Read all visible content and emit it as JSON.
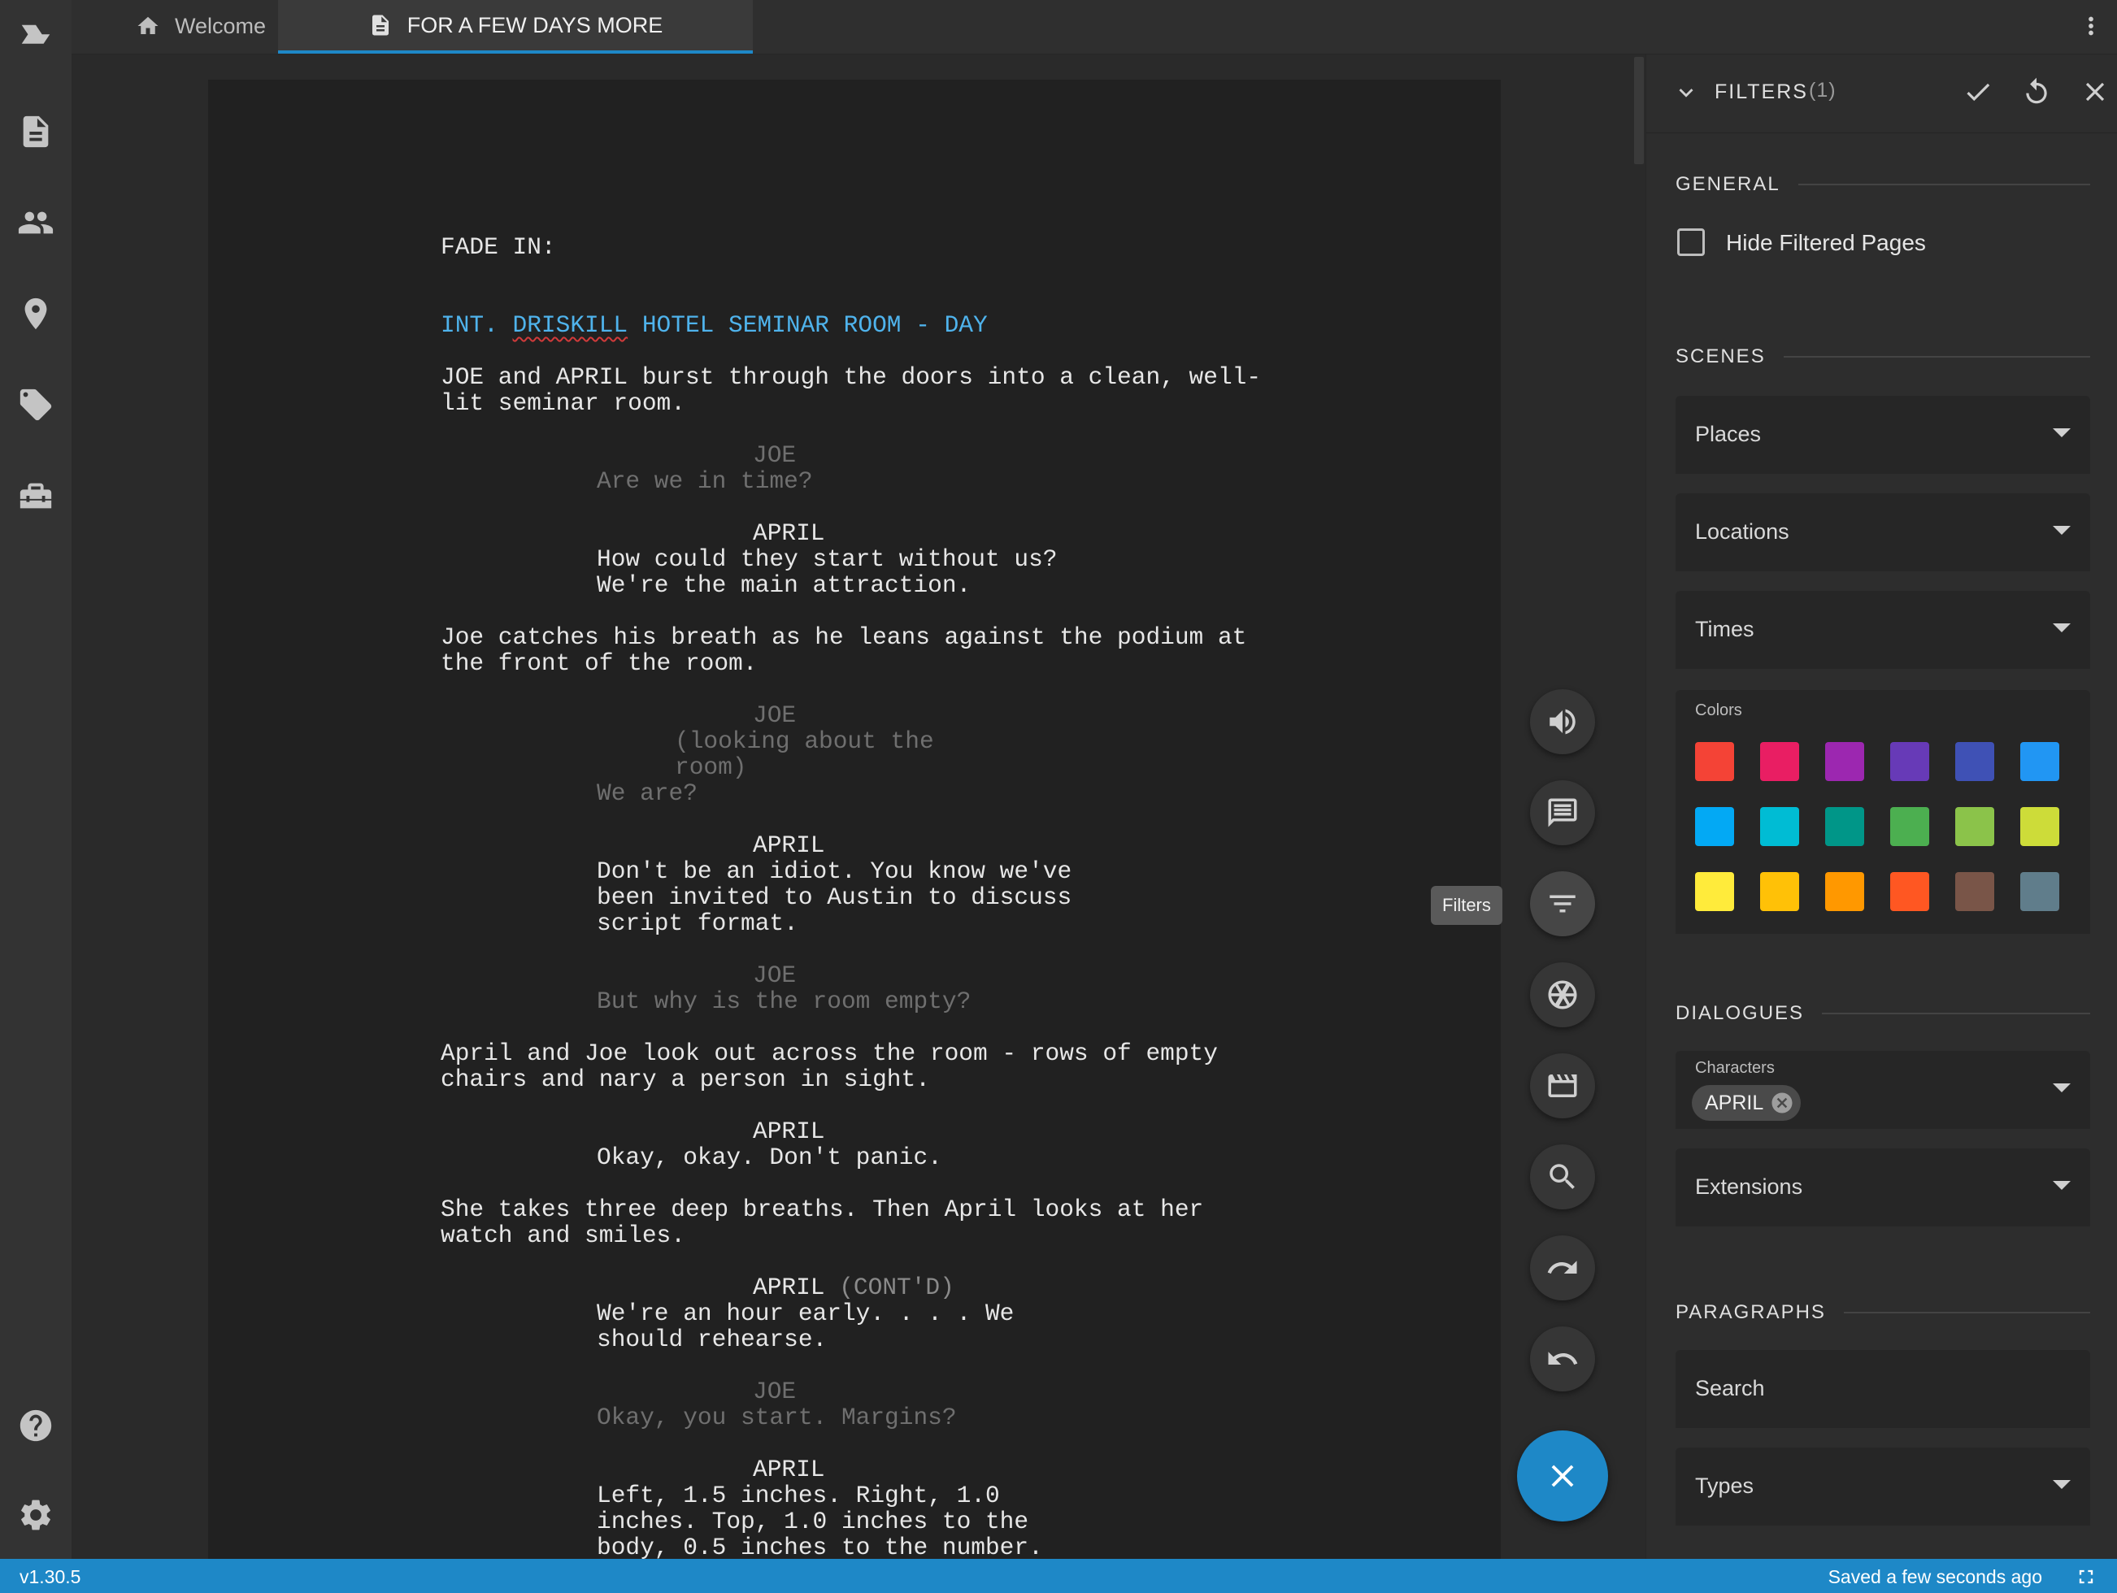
{
  "app": {
    "version": "v1.30.5",
    "status": "Saved a few seconds ago"
  },
  "activity_bar": {
    "items": [
      "logo-icon",
      "document-icon",
      "people-icon",
      "location-pin-icon",
      "tag-icon",
      "toolbox-icon"
    ],
    "bottom": [
      "help-icon",
      "settings-gear-icon"
    ]
  },
  "tabs": [
    {
      "label": "Welcome",
      "icon": "home-icon",
      "active": false
    },
    {
      "label": "FOR A FEW DAYS MORE",
      "icon": "document-icon",
      "active": true
    }
  ],
  "script": {
    "lines": [
      {
        "text": "FADE IN:",
        "style": "normal"
      },
      {
        "text": "INT. DRISKILL HOTEL SEMINAR ROOM - DAY",
        "style": "scene"
      },
      {
        "text": "JOE and APRIL burst through the doors into a clean, well-",
        "style": "normal"
      },
      {
        "text": "lit seminar room.",
        "style": "normal"
      },
      {
        "text": "JOE",
        "style": "dim"
      },
      {
        "text": "Are we in time?",
        "style": "dim"
      },
      {
        "text": "APRIL",
        "style": "normal"
      },
      {
        "text": "How could they start without us?",
        "style": "normal"
      },
      {
        "text": "We're the main attraction.",
        "style": "normal"
      },
      {
        "text": "Joe catches his breath as he leans against the podium at",
        "style": "normal"
      },
      {
        "text": "the front of the room.",
        "style": "normal"
      },
      {
        "text": "JOE",
        "style": "dim"
      },
      {
        "text": "(looking about the",
        "style": "dim"
      },
      {
        "text": "room)",
        "style": "dim"
      },
      {
        "text": "We are?",
        "style": "dim"
      },
      {
        "text": "APRIL",
        "style": "normal"
      },
      {
        "text": "Don't be an idiot. You know we've",
        "style": "normal"
      },
      {
        "text": "been invited to Austin to discuss",
        "style": "normal"
      },
      {
        "text": "script format.",
        "style": "normal"
      },
      {
        "text": "JOE",
        "style": "dim"
      },
      {
        "text": "But why is the room empty?",
        "style": "dim"
      },
      {
        "text": "April and Joe look out across the room - rows of empty",
        "style": "normal"
      },
      {
        "text": "chairs and nary a person in sight.",
        "style": "normal"
      },
      {
        "text": "APRIL",
        "style": "normal"
      },
      {
        "text": "Okay, okay. Don't panic.",
        "style": "normal"
      },
      {
        "text": "She takes three deep breaths. Then April looks at her",
        "style": "normal"
      },
      {
        "text": "watch and smiles.",
        "style": "normal"
      },
      {
        "text": "APRIL",
        "style": "normal",
        "extension": "(CONT'D)"
      },
      {
        "text": "We're an hour early. . . . We",
        "style": "normal"
      },
      {
        "text": "should rehearse.",
        "style": "normal"
      },
      {
        "text": "JOE",
        "style": "dim"
      },
      {
        "text": "Okay, you start. Margins?",
        "style": "dim"
      },
      {
        "text": "APRIL",
        "style": "normal"
      },
      {
        "text": "Left, 1.5 inches. Right, 1.0",
        "style": "normal"
      },
      {
        "text": "inches. Top, 1.0 inches to the",
        "style": "normal"
      },
      {
        "text": "body, 0.5 inches to the number.",
        "style": "normal"
      }
    ]
  },
  "toolbar": {
    "buttons": [
      "speaker-icon",
      "comment-icon",
      "filter-icon",
      "aperture-icon",
      "clapperboard-icon",
      "search-icon",
      "redo-icon",
      "undo-icon"
    ],
    "tooltip": "Filters",
    "close": "close-icon"
  },
  "filters": {
    "title": "FILTERS",
    "count": "(1)",
    "general": {
      "heading": "GENERAL",
      "hide_filtered_pages": "Hide Filtered Pages"
    },
    "scenes": {
      "heading": "SCENES",
      "places": "Places",
      "locations": "Locations",
      "times": "Times",
      "colors_label": "Colors",
      "colors": [
        "#f44336",
        "#e91e63",
        "#9c27b0",
        "#673ab7",
        "#3f51b5",
        "#2196f3",
        "#03a9f4",
        "#00bcd4",
        "#009688",
        "#4caf50",
        "#8bc34a",
        "#cddc39",
        "#ffeb3b",
        "#ffc107",
        "#ff9800",
        "#ff5722",
        "#795548",
        "#607d8b"
      ]
    },
    "dialogues": {
      "heading": "DIALOGUES",
      "characters_label": "Characters",
      "character_chip": "APRIL",
      "extensions": "Extensions"
    },
    "paragraphs": {
      "heading": "PARAGRAPHS",
      "search_placeholder": "Search",
      "types": "Types"
    }
  }
}
